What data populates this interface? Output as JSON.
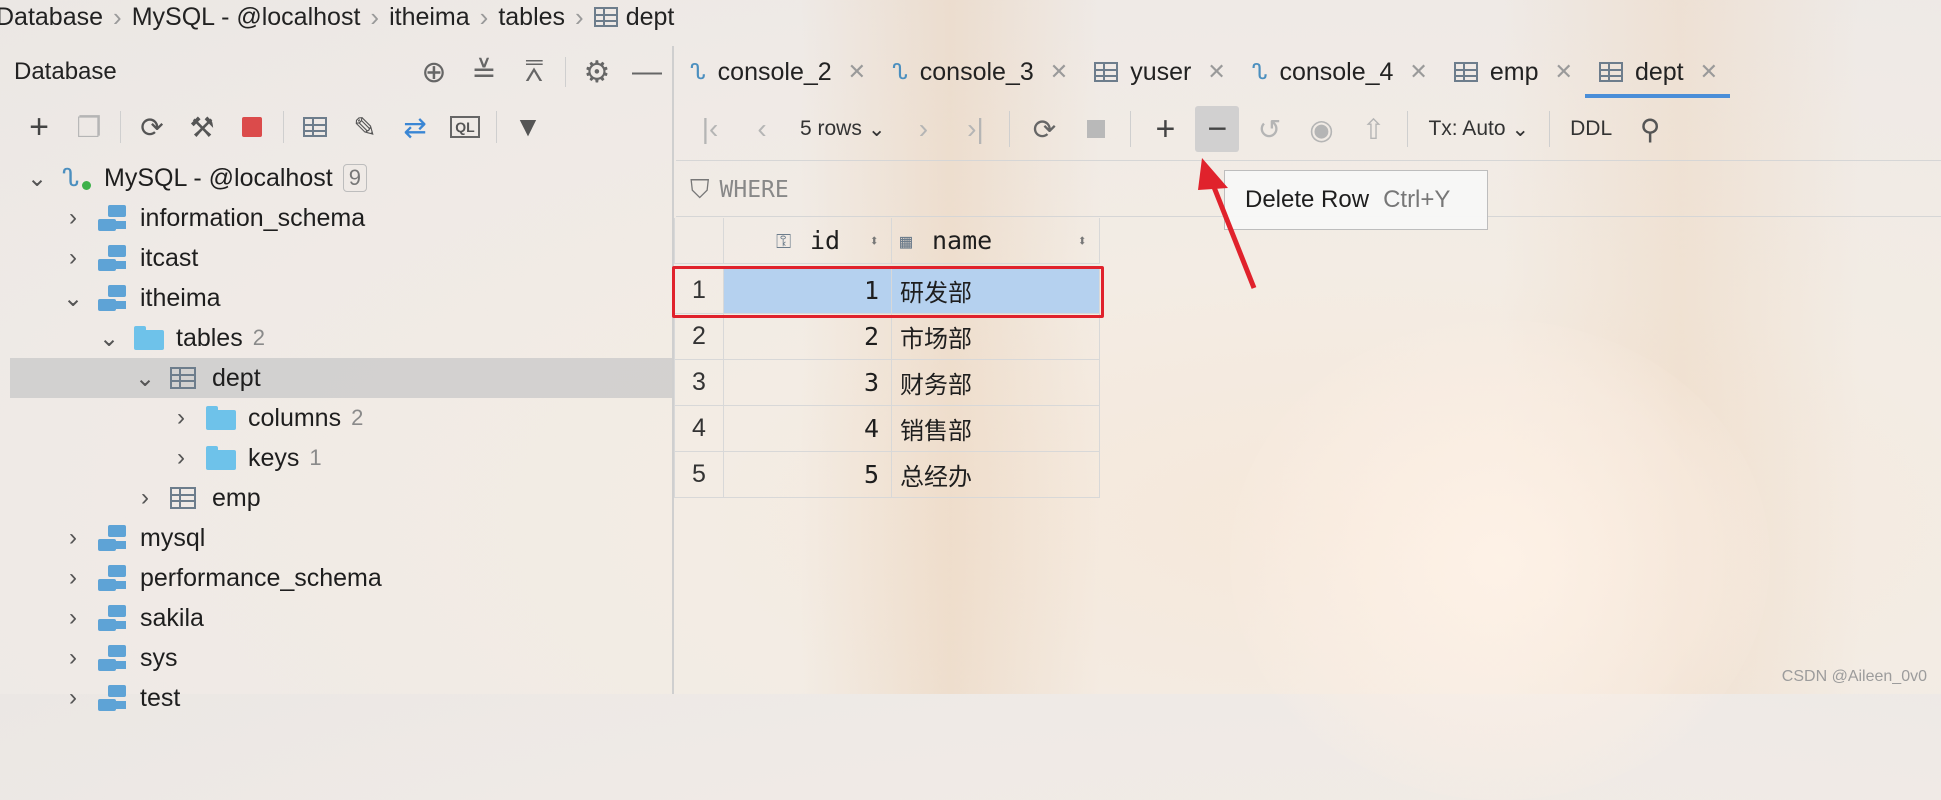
{
  "breadcrumb": [
    "Database",
    "MySQL - @localhost",
    "itheima",
    "tables",
    "dept"
  ],
  "left_panel": {
    "title": "Database",
    "header_icons": [
      "target-icon",
      "expand-all-icon",
      "collapse-all-icon",
      "gear-icon",
      "minimize-icon"
    ],
    "toolbar_icons": [
      "add-icon",
      "copy-icon",
      "refresh-icon",
      "schema-sync-icon",
      "stop-icon",
      "table-icon",
      "edit-icon",
      "jump-icon",
      "sql-console-icon",
      "filter-icon"
    ]
  },
  "tree": [
    {
      "label": "MySQL - @localhost",
      "badge": "9",
      "type": "connection",
      "level": 0,
      "expanded": true
    },
    {
      "label": "information_schema",
      "type": "schema",
      "level": 1,
      "expanded": false
    },
    {
      "label": "itcast",
      "type": "schema",
      "level": 1,
      "expanded": false
    },
    {
      "label": "itheima",
      "type": "schema",
      "level": 1,
      "expanded": true
    },
    {
      "label": "tables",
      "count": "2",
      "type": "folder",
      "level": 2,
      "expanded": true
    },
    {
      "label": "dept",
      "type": "table",
      "level": 3,
      "expanded": true,
      "selected": true
    },
    {
      "label": "columns",
      "count": "2",
      "type": "folder",
      "level": 4,
      "expanded": false
    },
    {
      "label": "keys",
      "count": "1",
      "type": "folder",
      "level": 4,
      "expanded": false
    },
    {
      "label": "emp",
      "type": "table",
      "level": 3,
      "expanded": false
    },
    {
      "label": "mysql",
      "type": "schema",
      "level": 1,
      "expanded": false
    },
    {
      "label": "performance_schema",
      "type": "schema",
      "level": 1,
      "expanded": false
    },
    {
      "label": "sakila",
      "type": "schema",
      "level": 1,
      "expanded": false
    },
    {
      "label": "sys",
      "type": "schema",
      "level": 1,
      "expanded": false
    },
    {
      "label": "test",
      "type": "schema",
      "level": 1,
      "expanded": false
    }
  ],
  "tabs": [
    {
      "label": "console_2",
      "type": "console"
    },
    {
      "label": "console_3",
      "type": "console"
    },
    {
      "label": "yuser",
      "type": "table"
    },
    {
      "label": "console_4",
      "type": "console"
    },
    {
      "label": "emp",
      "type": "table"
    },
    {
      "label": "dept",
      "type": "table",
      "active": true
    }
  ],
  "data_toolbar": {
    "rows_label": "5 rows",
    "tx_label": "Tx: Auto",
    "ddl_label": "DDL"
  },
  "where_label": "WHERE",
  "tooltip": {
    "text": "Delete Row",
    "shortcut": "Ctrl+Y"
  },
  "grid": {
    "columns": [
      "id",
      "name"
    ],
    "rows": [
      {
        "num": "1",
        "id": "1",
        "name": "研发部",
        "selected": true
      },
      {
        "num": "2",
        "id": "2",
        "name": "市场部"
      },
      {
        "num": "3",
        "id": "3",
        "name": "财务部"
      },
      {
        "num": "4",
        "id": "4",
        "name": "销售部"
      },
      {
        "num": "5",
        "id": "5",
        "name": "总经办"
      }
    ]
  },
  "watermark": "CSDN @Aileen_0v0",
  "colors": {
    "accent": "#4a8ed8",
    "selection": "#b5d1ef",
    "highlight_border": "#e0222c",
    "arrow": "#e0222c",
    "tree_selected": "#c8c8c8"
  }
}
